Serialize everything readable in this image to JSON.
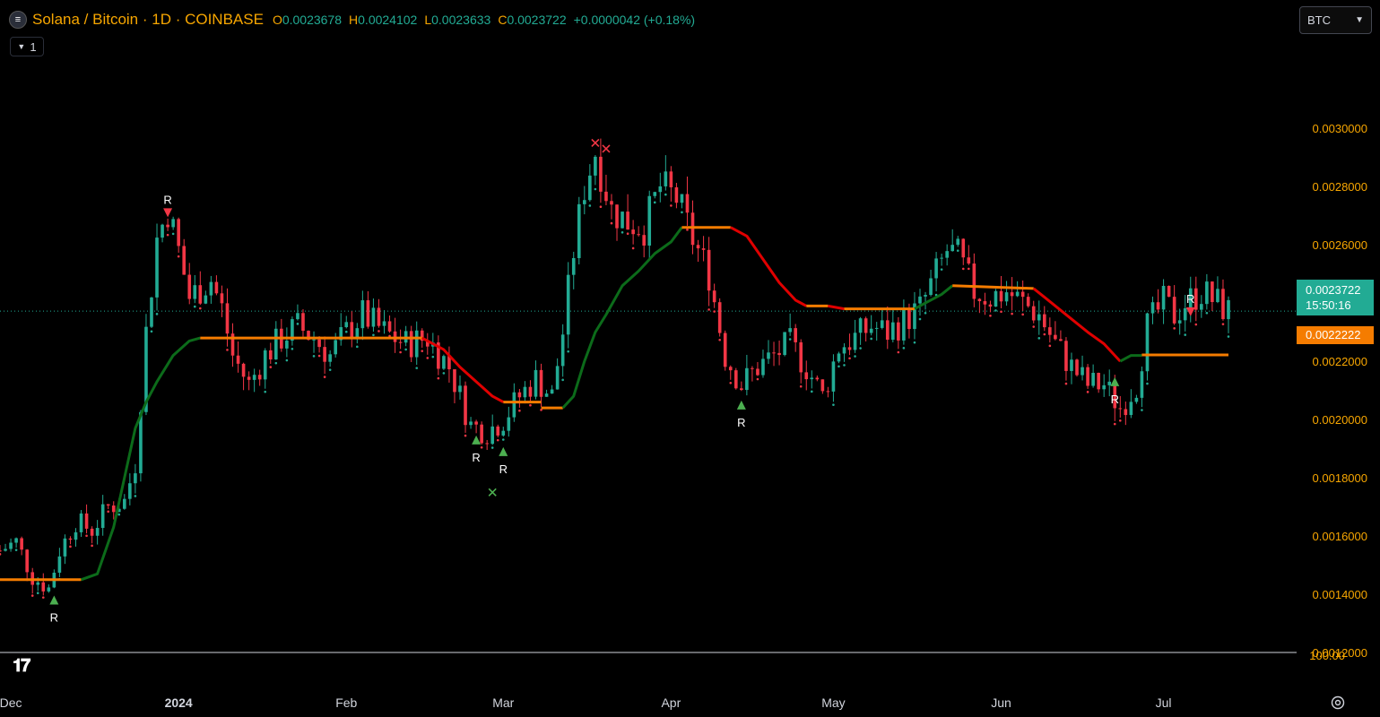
{
  "legend": {
    "symbol_icon": "solana-logo-icon",
    "title": "Solana / Bitcoin · 1D · COINBASE",
    "o_label": "O",
    "o": "0.0023678",
    "h_label": "H",
    "h": "0.0024102",
    "l_label": "L",
    "l": "0.0023633",
    "c_label": "C",
    "c": "0.0023722",
    "change": "+0.0000042 (+0.18%)",
    "collapse_count": "1"
  },
  "currency_select": {
    "value": "BTC"
  },
  "price_tags": {
    "last_price": "0.0023722",
    "countdown": "15:50:16",
    "indicator_price": "0.0022222"
  },
  "icons": {
    "logo": "tradingview-logo-icon",
    "settings": "gear-icon"
  },
  "colors": {
    "background": "#000000",
    "up": "#22ab94",
    "down": "#f23645",
    "trend_up": "#0c6b1a",
    "trend_down": "#e00000",
    "flat": "#f57c00",
    "axis_text": "#f7a600",
    "bottom_axis_text": "#d1d4dc"
  },
  "chart_data": {
    "type": "candlestick",
    "y_axis": {
      "range": [
        0.0012,
        0.00325
      ],
      "ticks": [
        "0.0030000",
        "0.0028000",
        "0.0026000",
        "0.0024000",
        "0.0022000",
        "0.0020000",
        "0.0018000",
        "0.0016000",
        "0.0014000",
        "0.0012000"
      ],
      "right_edge_label": "100.00"
    },
    "x_axis": {
      "start": "2023-11-29",
      "end": "2024-07-13",
      "ticks": [
        {
          "label": "Dec",
          "date": "2023-12-01"
        },
        {
          "label": "2024",
          "date": "2024-01-01"
        },
        {
          "label": "Feb",
          "date": "2024-02-01"
        },
        {
          "label": "Mar",
          "date": "2024-03-01"
        },
        {
          "label": "Apr",
          "date": "2024-04-01"
        },
        {
          "label": "May",
          "date": "2024-05-01"
        },
        {
          "label": "Jun",
          "date": "2024-06-01"
        },
        {
          "label": "Jul",
          "date": "2024-07-01"
        }
      ]
    },
    "closes": [
      [
        "2023-11-29",
        0.00155
      ],
      [
        "2023-12-02",
        0.00158
      ],
      [
        "2023-12-05",
        0.00146
      ],
      [
        "2023-12-08",
        0.00142
      ],
      [
        "2023-12-10",
        0.00155
      ],
      [
        "2023-12-13",
        0.00165
      ],
      [
        "2023-12-16",
        0.00162
      ],
      [
        "2023-12-19",
        0.0017
      ],
      [
        "2023-12-22",
        0.00172
      ],
      [
        "2023-12-24",
        0.00185
      ],
      [
        "2023-12-26",
        0.0023
      ],
      [
        "2023-12-28",
        0.00262
      ],
      [
        "2023-12-30",
        0.00272
      ],
      [
        "2024-01-01",
        0.00258
      ],
      [
        "2024-01-03",
        0.00242
      ],
      [
        "2024-01-05",
        0.00245
      ],
      [
        "2024-01-07",
        0.00248
      ],
      [
        "2024-01-09",
        0.00238
      ],
      [
        "2024-01-11",
        0.00222
      ],
      [
        "2024-01-14",
        0.00212
      ],
      [
        "2024-01-17",
        0.00222
      ],
      [
        "2024-01-20",
        0.00228
      ],
      [
        "2024-01-23",
        0.00232
      ],
      [
        "2024-01-26",
        0.00228
      ],
      [
        "2024-01-29",
        0.00222
      ],
      [
        "2024-02-01",
        0.0023
      ],
      [
        "2024-02-04",
        0.00236
      ],
      [
        "2024-02-08",
        0.0023
      ],
      [
        "2024-02-12",
        0.00226
      ],
      [
        "2024-02-16",
        0.00228
      ],
      [
        "2024-02-20",
        0.00218
      ],
      [
        "2024-02-24",
        0.00198
      ],
      [
        "2024-02-27",
        0.00196
      ],
      [
        "2024-03-01",
        0.002
      ],
      [
        "2024-03-04",
        0.00208
      ],
      [
        "2024-03-07",
        0.00214
      ],
      [
        "2024-03-10",
        0.00208
      ],
      [
        "2024-03-12",
        0.0023
      ],
      [
        "2024-03-14",
        0.00258
      ],
      [
        "2024-03-16",
        0.0028
      ],
      [
        "2024-03-18",
        0.00292
      ],
      [
        "2024-03-21",
        0.00272
      ],
      [
        "2024-03-24",
        0.00268
      ],
      [
        "2024-03-27",
        0.00266
      ],
      [
        "2024-03-30",
        0.0028
      ],
      [
        "2024-04-02",
        0.00276
      ],
      [
        "2024-04-05",
        0.00262
      ],
      [
        "2024-04-08",
        0.0025
      ],
      [
        "2024-04-11",
        0.00222
      ],
      [
        "2024-04-14",
        0.00212
      ],
      [
        "2024-04-17",
        0.00218
      ],
      [
        "2024-04-20",
        0.00222
      ],
      [
        "2024-04-23",
        0.00226
      ],
      [
        "2024-04-26",
        0.00218
      ],
      [
        "2024-04-29",
        0.00208
      ],
      [
        "2024-05-02",
        0.00225
      ],
      [
        "2024-05-05",
        0.00228
      ],
      [
        "2024-05-08",
        0.00232
      ],
      [
        "2024-05-11",
        0.0023
      ],
      [
        "2024-05-14",
        0.00234
      ],
      [
        "2024-05-17",
        0.00238
      ],
      [
        "2024-05-20",
        0.0025
      ],
      [
        "2024-05-22",
        0.00258
      ],
      [
        "2024-05-24",
        0.00256
      ],
      [
        "2024-05-27",
        0.00244
      ],
      [
        "2024-05-30",
        0.00242
      ],
      [
        "2024-06-02",
        0.00244
      ],
      [
        "2024-06-05",
        0.0024
      ],
      [
        "2024-06-08",
        0.00236
      ],
      [
        "2024-06-11",
        0.00226
      ],
      [
        "2024-06-14",
        0.00218
      ],
      [
        "2024-06-17",
        0.00212
      ],
      [
        "2024-06-20",
        0.00212
      ],
      [
        "2024-06-23",
        0.00204
      ],
      [
        "2024-06-26",
        0.00212
      ],
      [
        "2024-06-28",
        0.00232
      ],
      [
        "2024-07-01",
        0.0024
      ],
      [
        "2024-07-03",
        0.00236
      ],
      [
        "2024-07-05",
        0.0024
      ],
      [
        "2024-07-08",
        0.00244
      ],
      [
        "2024-07-11",
        0.0024
      ],
      [
        "2024-07-13",
        0.002372
      ]
    ],
    "trend_line": {
      "segments": [
        {
          "state": "flat",
          "points": [
            [
              "2023-11-29",
              0.00145
            ],
            [
              "2023-12-14",
              0.00145
            ]
          ]
        },
        {
          "state": "up",
          "points": [
            [
              "2023-12-14",
              0.00145
            ],
            [
              "2023-12-17",
              0.00147
            ],
            [
              "2023-12-20",
              0.00163
            ],
            [
              "2023-12-22",
              0.0018
            ],
            [
              "2023-12-24",
              0.00197
            ],
            [
              "2023-12-26",
              0.00206
            ],
            [
              "2023-12-28",
              0.00213
            ],
            [
              "2023-12-31",
              0.00222
            ],
            [
              "2024-01-03",
              0.00227
            ],
            [
              "2024-01-05",
              0.00228
            ]
          ]
        },
        {
          "state": "flat",
          "points": [
            [
              "2024-01-05",
              0.00228
            ],
            [
              "2024-02-15",
              0.00228
            ]
          ]
        },
        {
          "state": "down",
          "points": [
            [
              "2024-02-15",
              0.00228
            ],
            [
              "2024-02-19",
              0.00224
            ],
            [
              "2024-02-22",
              0.00218
            ],
            [
              "2024-02-25",
              0.00213
            ],
            [
              "2024-02-28",
              0.00208
            ],
            [
              "2024-03-01",
              0.00206
            ]
          ]
        },
        {
          "state": "flat",
          "points": [
            [
              "2024-03-01",
              0.00206
            ],
            [
              "2024-03-08",
              0.00206
            ]
          ]
        },
        {
          "state": "flat",
          "points": [
            [
              "2024-03-08",
              0.00204
            ],
            [
              "2024-03-12",
              0.00204
            ]
          ]
        },
        {
          "state": "up",
          "points": [
            [
              "2024-03-12",
              0.00204
            ],
            [
              "2024-03-14",
              0.00208
            ],
            [
              "2024-03-16",
              0.0022
            ],
            [
              "2024-03-18",
              0.0023
            ],
            [
              "2024-03-20",
              0.00236
            ],
            [
              "2024-03-23",
              0.00246
            ],
            [
              "2024-03-26",
              0.00251
            ],
            [
              "2024-03-29",
              0.00257
            ],
            [
              "2024-04-01",
              0.00261
            ],
            [
              "2024-04-03",
              0.00266
            ]
          ]
        },
        {
          "state": "flat",
          "points": [
            [
              "2024-04-03",
              0.00266
            ],
            [
              "2024-04-12",
              0.00266
            ]
          ]
        },
        {
          "state": "down",
          "points": [
            [
              "2024-04-12",
              0.00266
            ],
            [
              "2024-04-15",
              0.00263
            ],
            [
              "2024-04-18",
              0.00255
            ],
            [
              "2024-04-21",
              0.00247
            ],
            [
              "2024-04-24",
              0.00241
            ],
            [
              "2024-04-26",
              0.00239
            ]
          ]
        },
        {
          "state": "flat",
          "points": [
            [
              "2024-04-26",
              0.00239
            ],
            [
              "2024-04-30",
              0.00239
            ]
          ]
        },
        {
          "state": "down",
          "points": [
            [
              "2024-04-30",
              0.00239
            ],
            [
              "2024-05-03",
              0.00238
            ]
          ]
        },
        {
          "state": "flat",
          "points": [
            [
              "2024-05-03",
              0.00238
            ],
            [
              "2024-05-16",
              0.00238
            ]
          ]
        },
        {
          "state": "up",
          "points": [
            [
              "2024-05-16",
              0.00238
            ],
            [
              "2024-05-18",
              0.0024
            ],
            [
              "2024-05-21",
              0.00243
            ],
            [
              "2024-05-23",
              0.00246
            ]
          ]
        },
        {
          "state": "flat",
          "points": [
            [
              "2024-05-23",
              0.00246
            ],
            [
              "2024-06-07",
              0.00245
            ]
          ]
        },
        {
          "state": "down",
          "points": [
            [
              "2024-06-07",
              0.00245
            ],
            [
              "2024-06-09",
              0.00242
            ],
            [
              "2024-06-13",
              0.00236
            ],
            [
              "2024-06-17",
              0.0023
            ],
            [
              "2024-06-20",
              0.00226
            ],
            [
              "2024-06-23",
              0.0022
            ]
          ]
        },
        {
          "state": "up",
          "points": [
            [
              "2024-06-23",
              0.0022
            ],
            [
              "2024-06-25",
              0.00222
            ],
            [
              "2024-06-27",
              0.00222
            ]
          ]
        },
        {
          "state": "flat",
          "points": [
            [
              "2024-06-27",
              0.002222
            ],
            [
              "2024-07-13",
              0.002222
            ]
          ]
        }
      ]
    },
    "signals": [
      {
        "date": "2023-12-09",
        "price": 0.00138,
        "type": "buy",
        "label": "R"
      },
      {
        "date": "2023-12-30",
        "price": 0.00271,
        "type": "sell",
        "label": "R"
      },
      {
        "date": "2024-02-25",
        "price": 0.00193,
        "type": "buy",
        "label": "R"
      },
      {
        "date": "2024-03-01",
        "price": 0.00189,
        "type": "buy",
        "label": "R"
      },
      {
        "date": "2024-04-14",
        "price": 0.00205,
        "type": "buy",
        "label": "R"
      },
      {
        "date": "2024-06-22",
        "price": 0.00213,
        "type": "buy",
        "label": "R"
      },
      {
        "date": "2024-07-06",
        "price": 0.00237,
        "type": "sell",
        "label": "R"
      }
    ],
    "cross_markers": [
      {
        "date": "2024-02-28",
        "price": 0.00175,
        "type": "up"
      },
      {
        "date": "2024-03-18",
        "price": 0.00295,
        "type": "down"
      },
      {
        "date": "2024-03-20",
        "price": 0.00293,
        "type": "down"
      }
    ],
    "last_price_line": 0.0023722
  }
}
